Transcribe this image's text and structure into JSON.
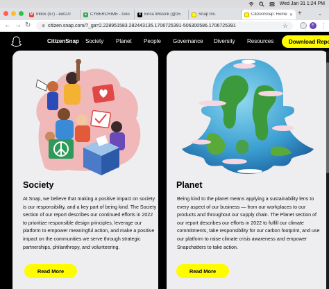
{
  "system": {
    "date_time": "Wed Jan 31  1:24 PM"
  },
  "tabs": [
    {
      "title": "Inbox (97) - ew110",
      "favicon": "gmail-icon",
      "color": "#ea4335",
      "active": false
    },
    {
      "title": "CYBERCRIME - Goo",
      "favicon": "google-drive-icon",
      "color": "#34a853",
      "active": false
    },
    {
      "title": "Erica Wissick (@15",
      "favicon": "x-icon",
      "color": "#000000",
      "active": false
    },
    {
      "title": "Snap Inc.",
      "favicon": "snap-icon",
      "color": "#fffc00",
      "active": false
    },
    {
      "title": "CitizenSnap: Home",
      "favicon": "snap-icon",
      "color": "#fffc00",
      "active": true
    }
  ],
  "browser": {
    "url": "citizen.snap.com/?_ga=2.228951583.282443135.1706725391-506300586.1706725391",
    "profile_initial": "E"
  },
  "site": {
    "brand": "CitizenSnap",
    "nav": [
      "Society",
      "Planet",
      "People",
      "Governance",
      "Diversity",
      "Resources"
    ],
    "download_label": "Download Report",
    "accent": "#fffc00"
  },
  "cards": [
    {
      "title": "Society",
      "body": "At Snap, we believe that making a positive impact on society is our responsibility, and a key part of being kind. The Society section of our report describes our continued efforts in 2022 to prioritize responsible design principles, leverage our platform to empower meaningful action, and make a positive impact on the communities we serve through strategic partnerships, philanthropy, and volunteering.",
      "button": "Read More"
    },
    {
      "title": "Planet",
      "body": "Being kind to the planet means applying a sustainability lens to every aspect of our business — from our workplaces to our products and throughout our supply chain. The Planet section of our report describes our efforts in 2022 to fulfill our climate commitments, take responsibility for our carbon footprint, and use our platform to raise climate crisis awareness and empower Snapchatters to take action.",
      "button": "Read More"
    }
  ]
}
